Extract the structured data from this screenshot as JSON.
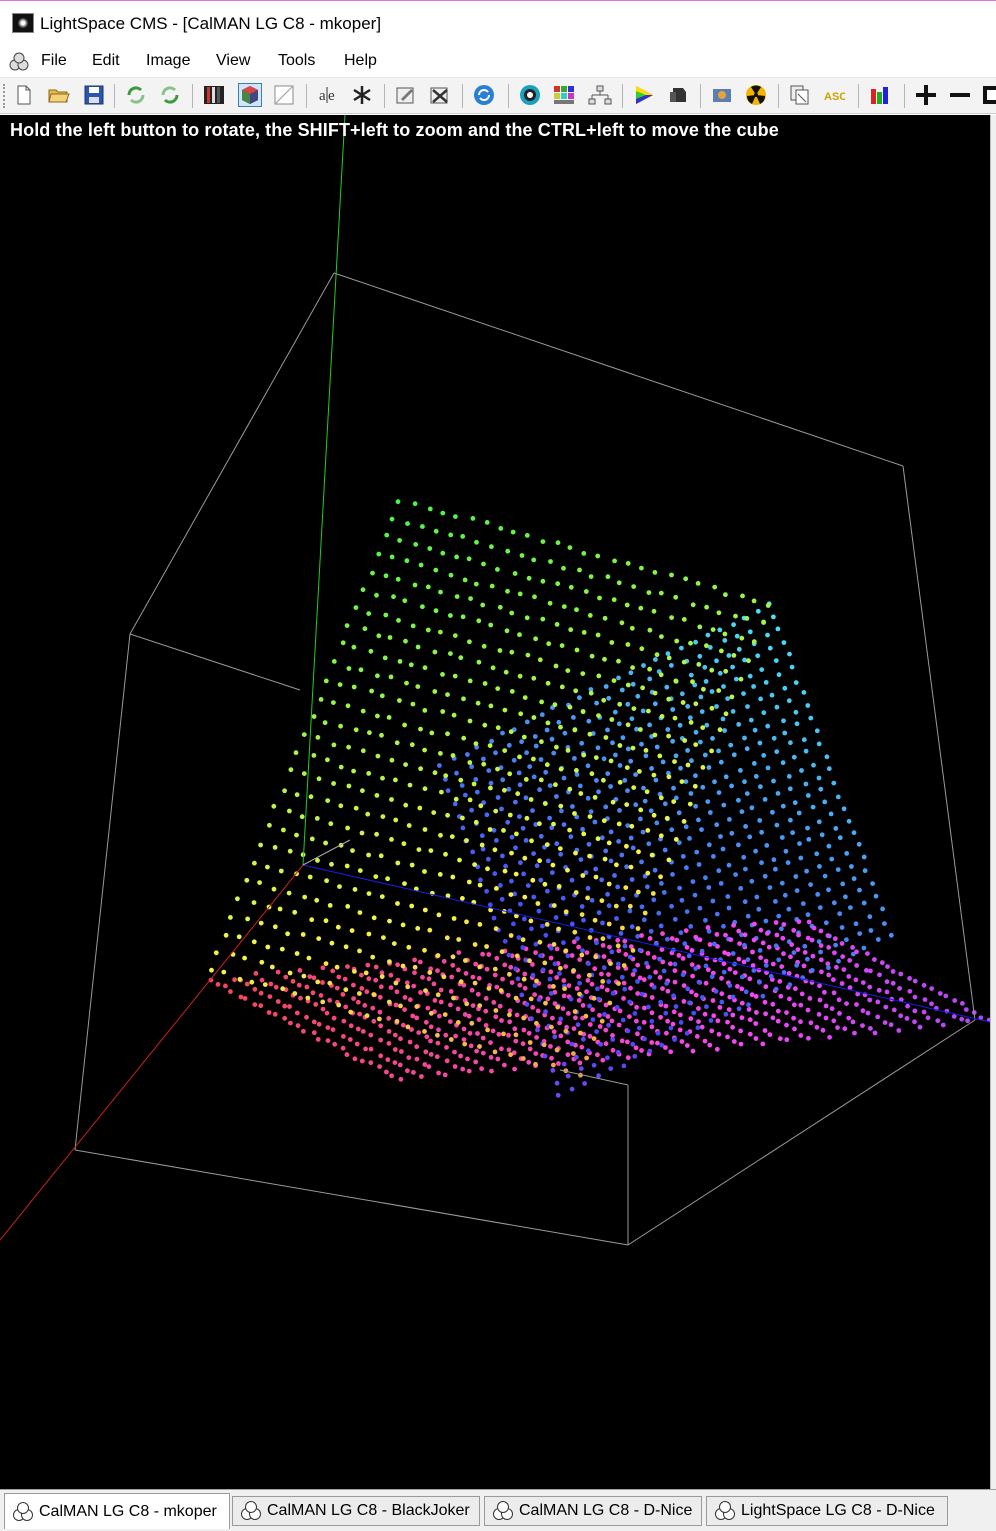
{
  "window": {
    "title": "LightSpace CMS - [CalMAN LG C8 - mkoper]"
  },
  "menu": {
    "file": "File",
    "edit": "Edit",
    "image": "Image",
    "view": "View",
    "tools": "Tools",
    "help": "Help"
  },
  "toolbar": {
    "buttons": [
      "new-doc-icon",
      "open-folder-icon",
      "save-disk-icon",
      "refresh-green-icon",
      "refresh-reverse-icon",
      "filmstrip-icon",
      "color-cube-icon",
      "blank-curve-icon",
      "text-tool-icon",
      "snowflake-icon",
      "edit-pad-icon",
      "cross-pad-icon",
      "sync-globe-icon",
      "target-circle-icon",
      "color-grid-icon",
      "network-icon",
      "color-prism-icon",
      "probe-icon",
      "tools-icon",
      "nuclear-icon",
      "copy-pages-icon",
      "asc-icon",
      "rgb-bars-icon",
      "plus-icon",
      "minus-icon",
      "expand-icon"
    ]
  },
  "viewport": {
    "hint": "Hold the left button to rotate, the SHIFT+left to zoom and the CTRL+left to move the cube",
    "background": "#000000",
    "axis_colors": {
      "red": "#cc2020",
      "green": "#22cc22",
      "blue": "#1a1aee",
      "box": "#9a9a9a"
    }
  },
  "tabs": [
    {
      "label": "CalMAN LG C8 - mkoper",
      "active": true
    },
    {
      "label": "CalMAN LG C8 - BlackJoker",
      "active": false
    },
    {
      "label": "CalMAN LG C8 - D-Nice",
      "active": false
    },
    {
      "label": "LightSpace LG C8 - D-Nice",
      "active": false
    }
  ]
}
